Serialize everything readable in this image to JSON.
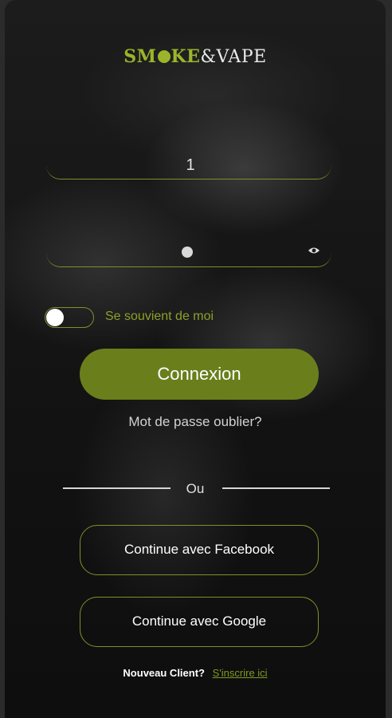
{
  "logo": {
    "part1": "SM",
    "part2": "KE",
    "part3": "&",
    "part4": "VAPE"
  },
  "login_form": {
    "username_value": "1",
    "password_mask": "●",
    "eye_icon": "eye-icon",
    "remember_label": "Se souvient de moi",
    "remember_checked": false,
    "submit_label": "Connexion",
    "forgot_label": "Mot de passe oublier?"
  },
  "divider": {
    "label": "Ou"
  },
  "social": {
    "facebook_label": "Continue avec Facebook",
    "google_label": "Continue avec Google"
  },
  "signup": {
    "question": "Nouveau Client?",
    "link_label": "S'inscrire ici"
  },
  "colors": {
    "accent": "#6a7f1c",
    "accent_line": "#7f8f2a",
    "logo_green": "#9ab52a",
    "background": "#141414"
  }
}
